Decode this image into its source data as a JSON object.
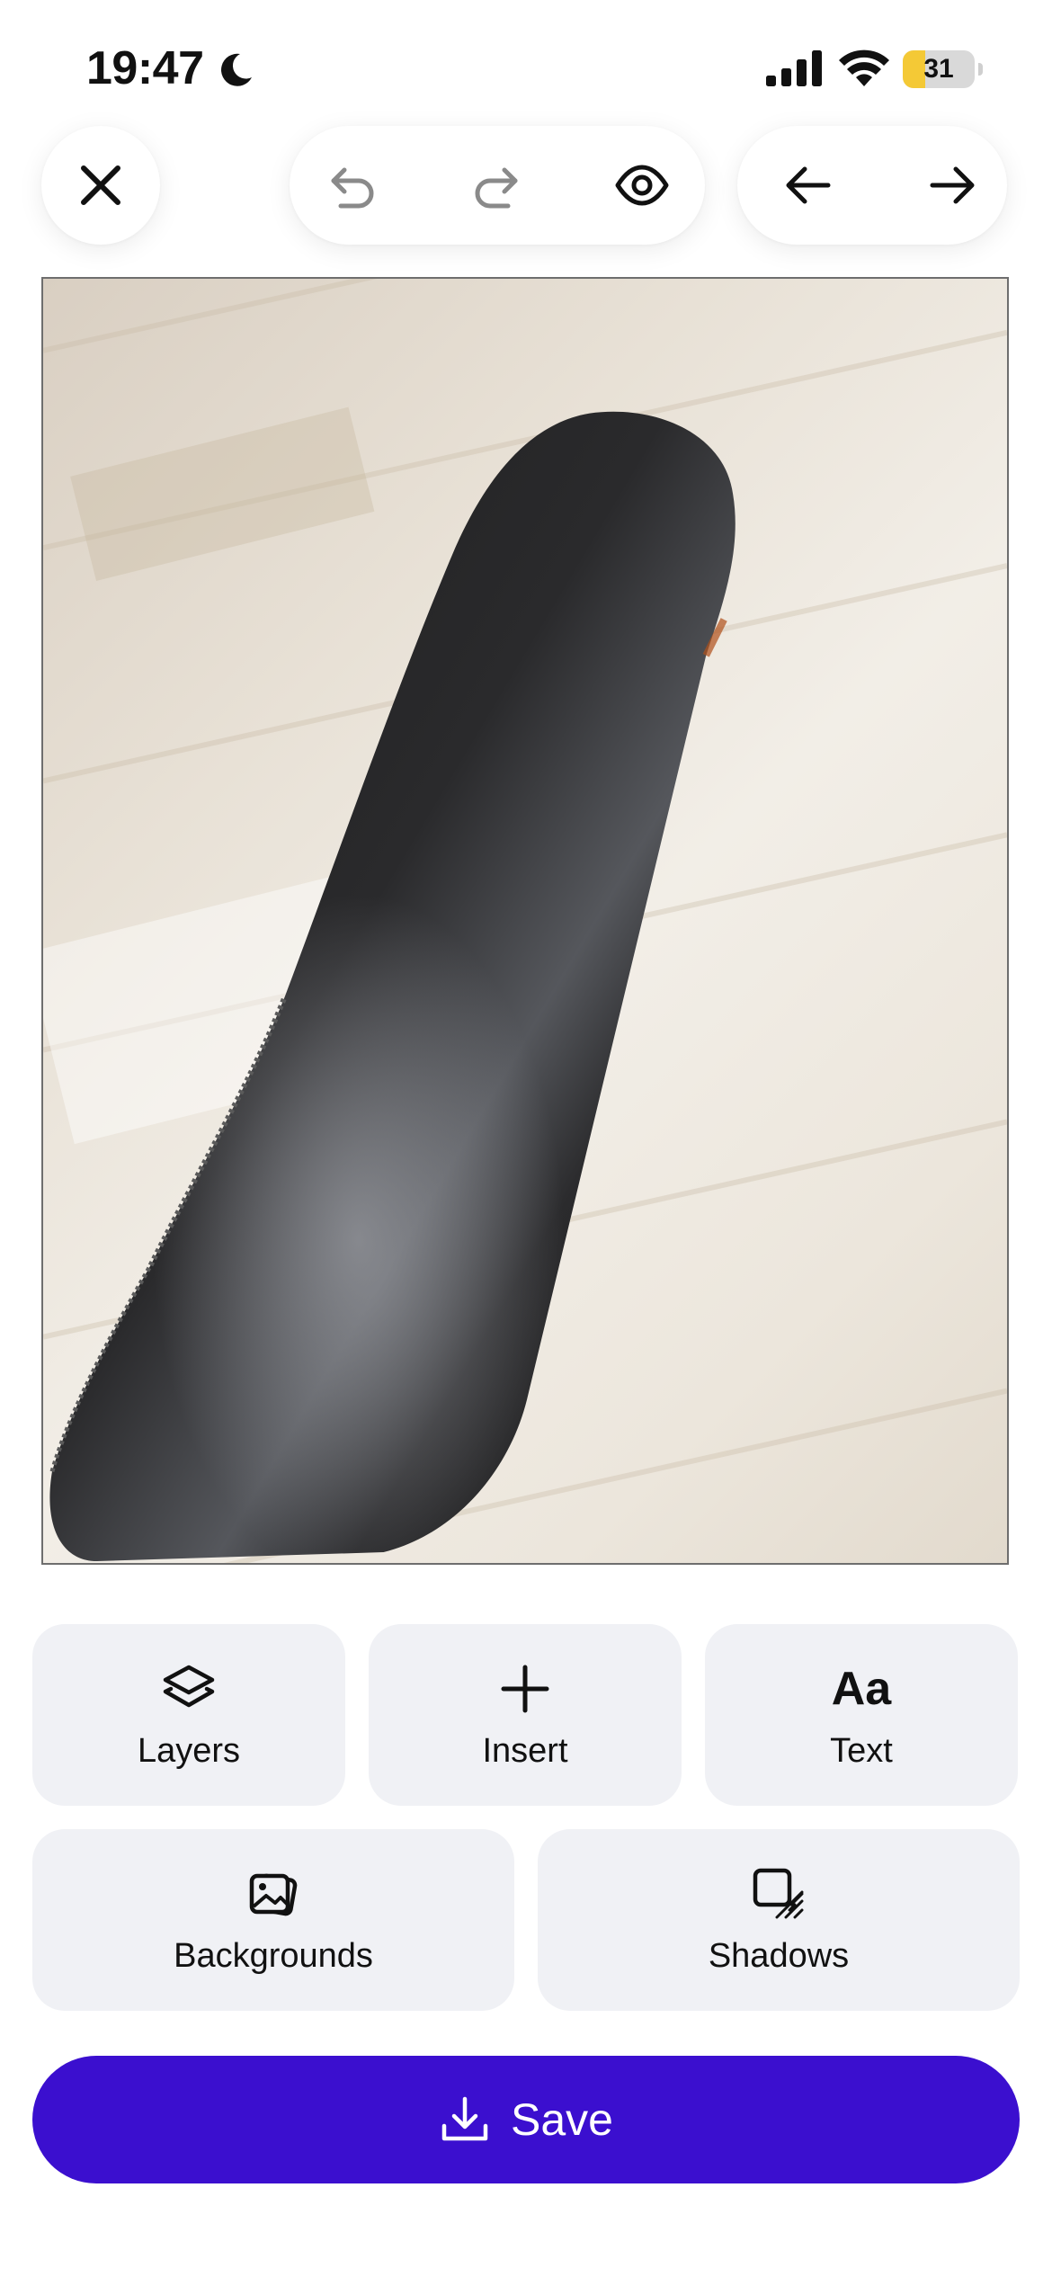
{
  "status_bar": {
    "time": "19:47",
    "battery_level": "31",
    "battery_fraction": 0.31,
    "icons": [
      "moon-icon",
      "cellular-signal-icon",
      "wifi-icon",
      "battery-icon"
    ]
  },
  "toolbar": {
    "close_icon": "close-icon",
    "undo_icon": "undo-icon",
    "redo_icon": "redo-icon",
    "preview_icon": "eye-icon",
    "back_icon": "arrow-left-icon",
    "forward_icon": "arrow-right-icon"
  },
  "tools": [
    {
      "label": "Layers",
      "icon": "layers-icon"
    },
    {
      "label": "Insert",
      "icon": "plus-icon"
    },
    {
      "label": "Text",
      "icon": "text-icon",
      "glyph": "Aa"
    },
    {
      "label": "Backgrounds",
      "icon": "image-stack-icon"
    },
    {
      "label": "Shadows",
      "icon": "shadow-icon"
    }
  ],
  "save": {
    "label": "Save",
    "icon": "download-icon"
  },
  "colors": {
    "accent": "#3b0fcf",
    "tile_background": "#f0f1f5",
    "disabled_icon": "#8a8a8a"
  }
}
